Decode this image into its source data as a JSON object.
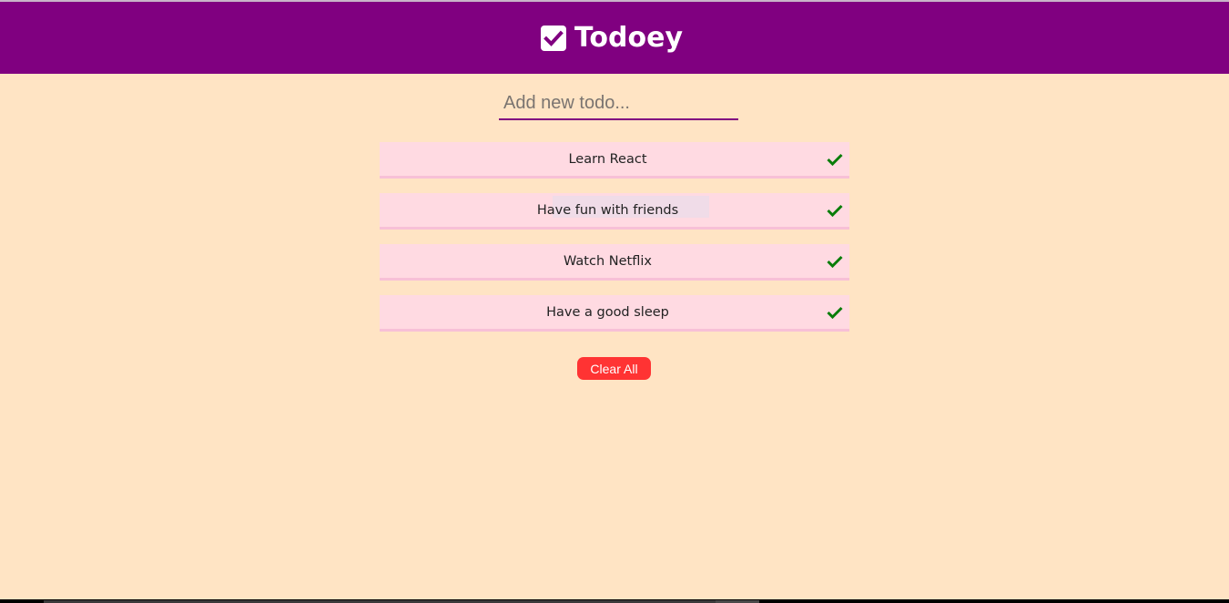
{
  "header": {
    "title": "Todoey",
    "logo_icon": "checkbox-checked-icon",
    "background": "#800080"
  },
  "input": {
    "placeholder": "Add new todo...",
    "value": ""
  },
  "todos": [
    {
      "text": "Learn React",
      "icon": "check-icon"
    },
    {
      "text": "Have fun with friends",
      "icon": "check-icon"
    },
    {
      "text": "Watch Netflix",
      "icon": "check-icon"
    },
    {
      "text": "Have a good sleep",
      "icon": "check-icon"
    }
  ],
  "clear_button": {
    "label": "Clear All",
    "color": "#ff3333"
  },
  "colors": {
    "page_background": "#ffe4c4",
    "item_background": "#ffdae2",
    "check": "#0a7d0a"
  }
}
